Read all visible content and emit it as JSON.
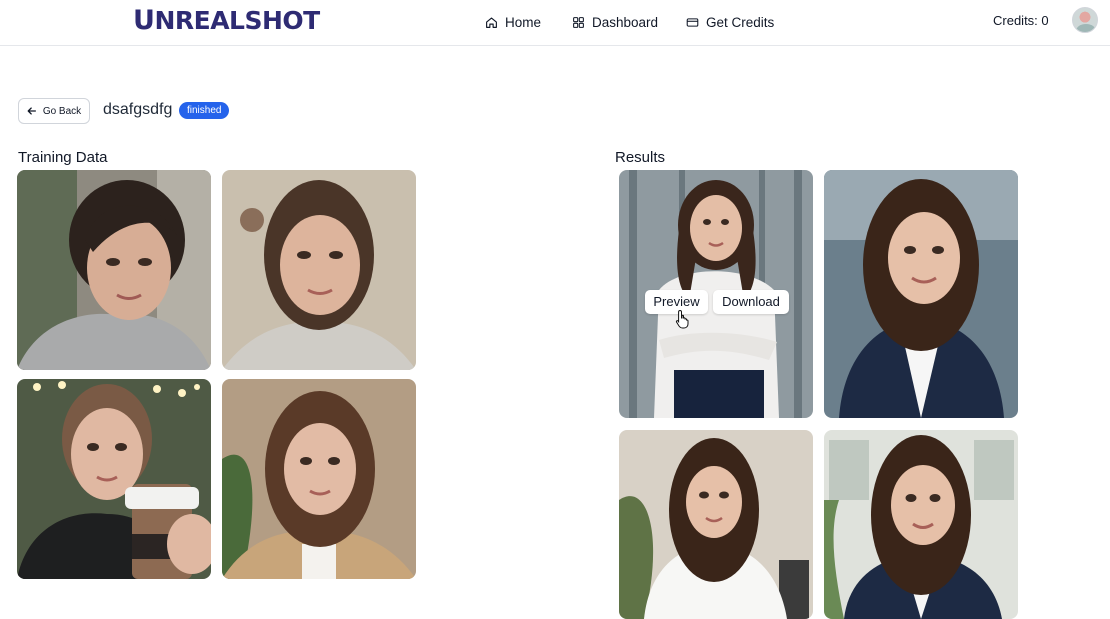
{
  "header": {
    "logo_first": "U",
    "logo_rest": "NREALSHOT",
    "nav": [
      {
        "label": "Home",
        "icon": "home-icon"
      },
      {
        "label": "Dashboard",
        "icon": "dashboard-icon"
      },
      {
        "label": "Get Credits",
        "icon": "credit-card-icon"
      }
    ],
    "credits_label": "Credits: 0"
  },
  "toolbar": {
    "back_label": "Go Back",
    "model_name": "dsafgsdfg",
    "status": "finished"
  },
  "sections": {
    "training_title": "Training Data",
    "results_title": "Results"
  },
  "overlay": {
    "preview_label": "Preview",
    "download_label": "Download"
  },
  "colors": {
    "brand": "#2e2b73",
    "status_badge": "#2563eb"
  },
  "training_images": [
    {
      "description": "woman selfie, short dark hair, grey sweater"
    },
    {
      "description": "woman selfie, bob hair, light top"
    },
    {
      "description": "woman holding coffee cup, string lights"
    },
    {
      "description": "woman with plants, tan jacket"
    }
  ],
  "result_images": [
    {
      "description": "professional headshot, white blouse, arms crossed, office"
    },
    {
      "description": "professional headshot, navy blazer, office"
    },
    {
      "description": "professional headshot, white shirt, plant background"
    },
    {
      "description": "professional headshot, navy blazer, bright office"
    }
  ]
}
